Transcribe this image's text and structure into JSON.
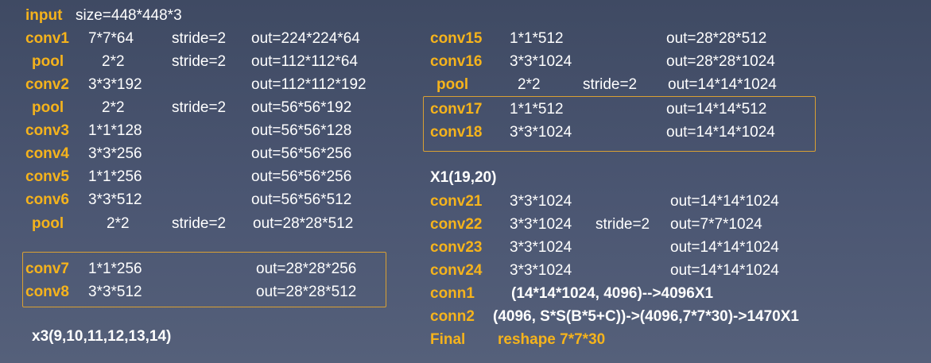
{
  "input_label": "input",
  "input_text": "size=448*448*3",
  "left_rows": [
    {
      "name": "conv1",
      "kernel": "7*7*64",
      "stride": "stride=2",
      "out": "out=224*224*64"
    },
    {
      "name": "pool",
      "kernel": "2*2",
      "stride": "stride=2",
      "out": "out=112*112*64"
    },
    {
      "name": "conv2",
      "kernel": "3*3*192",
      "stride": "",
      "out": "out=112*112*192"
    },
    {
      "name": "pool",
      "kernel": "2*2",
      "stride": "stride=2",
      "out": "out=56*56*192"
    },
    {
      "name": "conv3",
      "kernel": "1*1*128",
      "stride": "",
      "out": "out=56*56*128"
    },
    {
      "name": "conv4",
      "kernel": "3*3*256",
      "stride": "",
      "out": "out=56*56*256"
    },
    {
      "name": "conv5",
      "kernel": "1*1*256",
      "stride": "",
      "out": "out=56*56*256"
    },
    {
      "name": "conv6",
      "kernel": "3*3*512",
      "stride": "",
      "out": "out=56*56*512"
    },
    {
      "name": "pool",
      "kernel": "2*2",
      "stride": "stride=2",
      "out": "out=28*28*512"
    }
  ],
  "left_boxed_rows": [
    {
      "name": "conv7",
      "kernel": "1*1*256",
      "out": "out=28*28*256"
    },
    {
      "name": "conv8",
      "kernel": "3*3*512",
      "out": "out=28*28*512"
    }
  ],
  "left_repeat_note": "x3(9,10,11,12,13,14)",
  "right_rows_top": [
    {
      "name": "conv15",
      "kernel": "1*1*512",
      "stride": "",
      "out": "out=28*28*512"
    },
    {
      "name": "conv16",
      "kernel": "3*3*1024",
      "stride": "",
      "out": "out=28*28*1024"
    },
    {
      "name": "pool",
      "kernel": "2*2",
      "stride": "stride=2",
      "out": "out=14*14*1024"
    }
  ],
  "right_boxed_rows": [
    {
      "name": "conv17",
      "kernel": "1*1*512",
      "out": "out=14*14*512"
    },
    {
      "name": "conv18",
      "kernel": "3*3*1024",
      "out": "out=14*14*1024"
    }
  ],
  "right_repeat_note": "X1(19,20)",
  "right_rows_bottom": [
    {
      "name": "conv21",
      "kernel": "3*3*1024",
      "stride": "",
      "out": "out=14*14*1024"
    },
    {
      "name": "conv22",
      "kernel": "3*3*1024",
      "stride": "stride=2",
      "out": "out=7*7*1024"
    },
    {
      "name": "conv23",
      "kernel": "3*3*1024",
      "stride": "",
      "out": "out=14*14*1024"
    },
    {
      "name": "conv24",
      "kernel": "3*3*1024",
      "stride": "",
      "out": "out=14*14*1024"
    }
  ],
  "conn_rows": [
    {
      "name": "conn1",
      "text": "(14*14*1024, 4096)-->4096X1"
    },
    {
      "name": "conn2",
      "text": "(4096, S*S(B*5+C))->(4096,7*7*30)->1470X1"
    },
    {
      "name": "Final",
      "text": "reshape 7*7*30"
    }
  ],
  "colors": {
    "label": "#f5b31c",
    "text": "#ffffff",
    "box": "#d8a033",
    "background": "#46516b"
  }
}
